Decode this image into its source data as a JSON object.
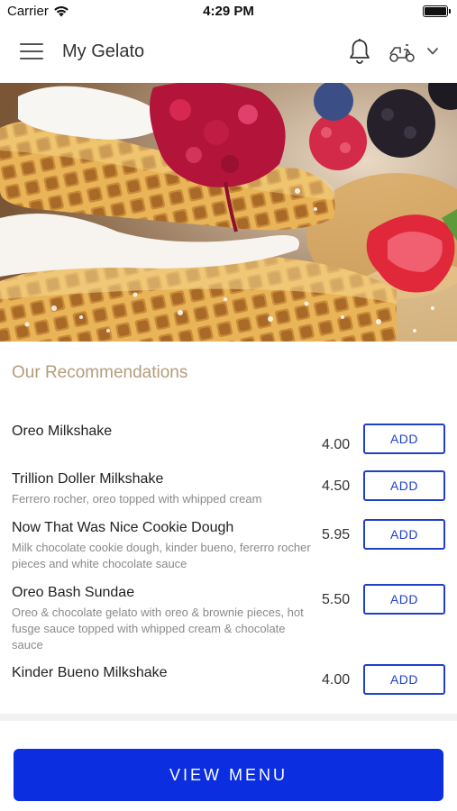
{
  "status_bar": {
    "carrier": "Carrier",
    "time": "4:29 PM",
    "wifi_icon": "wifi-icon",
    "battery_icon": "battery-full-icon"
  },
  "header": {
    "title": "My Gelato",
    "menu_icon": "hamburger-menu-icon",
    "notification_icon": "bell-icon",
    "delivery_icon": "scooter-icon",
    "dropdown_icon": "chevron-down-icon"
  },
  "hero": {
    "image": "waffles-with-berries-and-cream"
  },
  "recommendations": {
    "title": "Our Recommendations",
    "add_label": "ADD",
    "items": [
      {
        "name": "Oreo Milkshake",
        "description": "",
        "price": "4.00"
      },
      {
        "name": "Trillion Doller Milkshake",
        "description": "Ferrero rocher, oreo topped with whipped cream",
        "price": "4.50"
      },
      {
        "name": "Now That Was Nice Cookie Dough",
        "description": "Milk chocolate cookie dough, kinder bueno, fererro rocher pieces and white chocolate sauce",
        "price": "5.95"
      },
      {
        "name": "Oreo Bash Sundae",
        "description": "Oreo & chocolate gelato with oreo & brownie pieces, hot fusge sauce topped with whipped cream & chocolate sauce",
        "price": "5.50"
      },
      {
        "name": "Kinder Bueno Milkshake",
        "description": "",
        "price": "4.00"
      }
    ]
  },
  "footer": {
    "view_menu_label": "VIEW MENU"
  },
  "colors": {
    "accent": "#0a2ee0",
    "button_outline": "#2040c8",
    "section_title": "#b49d7a"
  }
}
